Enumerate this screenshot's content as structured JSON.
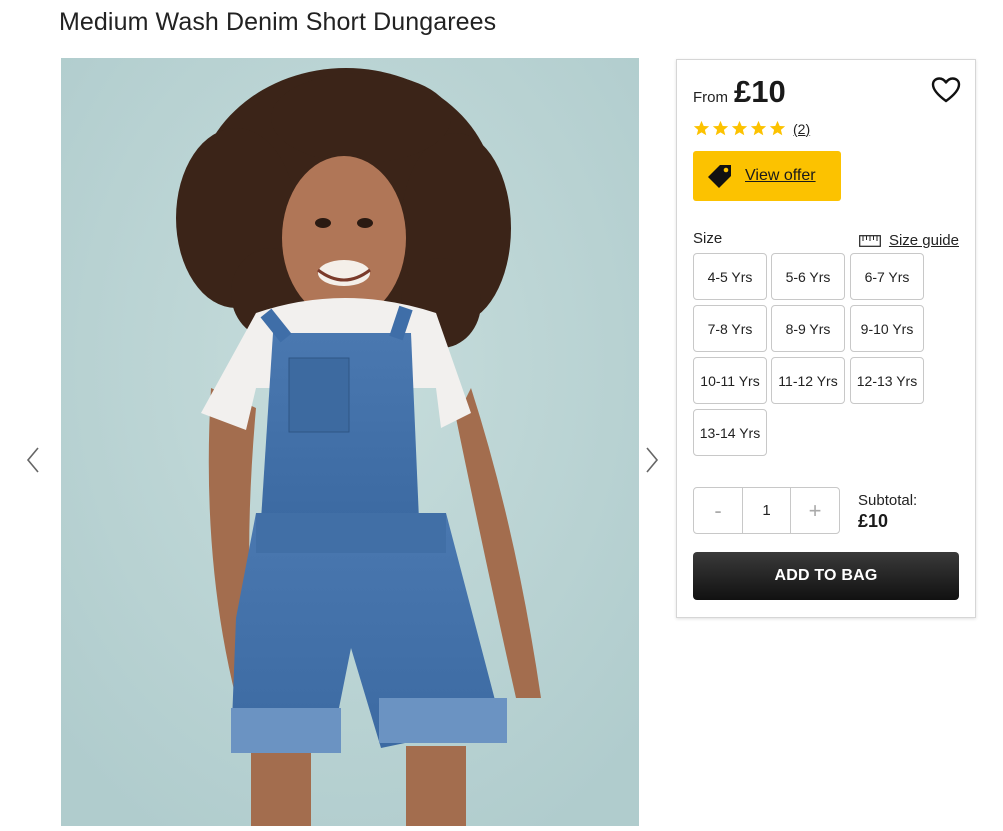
{
  "product": {
    "title": "Medium Wash Denim Short Dungarees"
  },
  "gallery": {
    "prev_icon": "chevron-left-icon",
    "next_icon": "chevron-right-icon",
    "colors": {
      "backdrop": "#bcd5d5",
      "denim": "#3f6ea8",
      "tshirt": "#f2f0ee",
      "hair": "#3b2418",
      "skin": "#a36d4e"
    }
  },
  "purchase": {
    "price_prefix": "From",
    "price": "£10",
    "wishlist_icon": "heart-outline-icon",
    "rating": {
      "stars": 5,
      "max": 5,
      "count_label": "(2)",
      "color": "#fcc200"
    },
    "offer": {
      "label": "View offer",
      "icon": "price-tag-icon",
      "color": "#fcc200"
    },
    "size_label": "Size",
    "size_guide_label": "Size guide",
    "sizes": [
      "4-5 Yrs",
      "5-6 Yrs",
      "6-7 Yrs",
      "7-8 Yrs",
      "8-9 Yrs",
      "9-10 Yrs",
      "10-11 Yrs",
      "11-12 Yrs",
      "12-13 Yrs",
      "13-14 Yrs"
    ],
    "quantity": {
      "minus": "-",
      "value": "1",
      "plus": "+"
    },
    "subtotal_label": "Subtotal:",
    "subtotal_value": "£10",
    "add_to_bag_label": "ADD TO BAG"
  }
}
